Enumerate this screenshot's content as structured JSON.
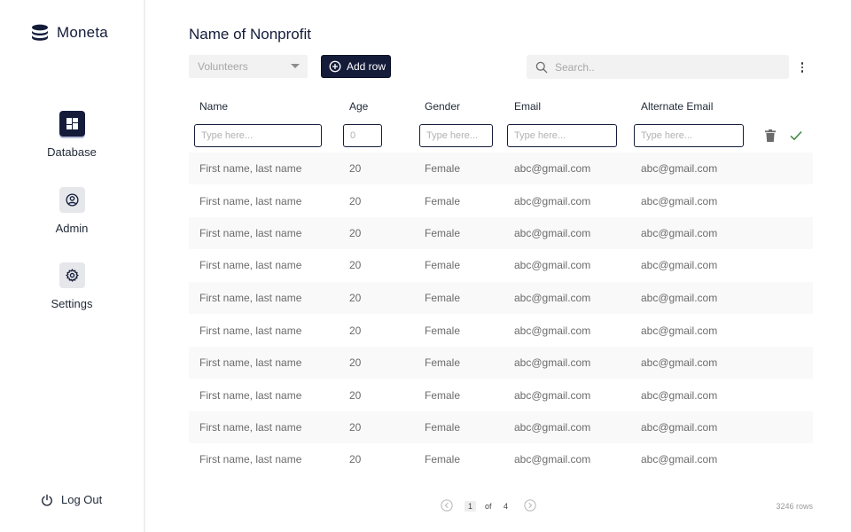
{
  "app": {
    "name": "Moneta"
  },
  "sidebar": {
    "items": [
      {
        "label": "Database",
        "icon": "grid-icon",
        "active": true
      },
      {
        "label": "Admin",
        "icon": "user-circle-icon",
        "active": false
      },
      {
        "label": "Settings",
        "icon": "gear-icon",
        "active": false
      }
    ],
    "logout_label": "Log Out"
  },
  "main": {
    "title": "Name of Nonprofit",
    "category_select": {
      "value": "Volunteers"
    },
    "add_row_label": "Add row",
    "search": {
      "placeholder": "Search.."
    }
  },
  "table": {
    "columns": [
      "Name",
      "Age",
      "Gender",
      "Email",
      "Alternate Email"
    ],
    "edit_row": {
      "name_placeholder": "Type here...",
      "age_placeholder": "0",
      "gender_placeholder": "Type here...",
      "email_placeholder": "Type here...",
      "alt_email_placeholder": "Type here..."
    },
    "rows": [
      [
        "First name, last name",
        "20",
        "Female",
        "abc@gmail.com",
        "abc@gmail.com"
      ],
      [
        "First name, last name",
        "20",
        "Female",
        "abc@gmail.com",
        "abc@gmail.com"
      ],
      [
        "First name, last name",
        "20",
        "Female",
        "abc@gmail.com",
        "abc@gmail.com"
      ],
      [
        "First name, last name",
        "20",
        "Female",
        "abc@gmail.com",
        "abc@gmail.com"
      ],
      [
        "First name, last name",
        "20",
        "Female",
        "abc@gmail.com",
        "abc@gmail.com"
      ],
      [
        "First name, last name",
        "20",
        "Female",
        "abc@gmail.com",
        "abc@gmail.com"
      ],
      [
        "First name, last name",
        "20",
        "Female",
        "abc@gmail.com",
        "abc@gmail.com"
      ],
      [
        "First name, last name",
        "20",
        "Female",
        "abc@gmail.com",
        "abc@gmail.com"
      ],
      [
        "First name, last name",
        "20",
        "Female",
        "abc@gmail.com",
        "abc@gmail.com"
      ],
      [
        "First name, last name",
        "20",
        "Female",
        "abc@gmail.com",
        "abc@gmail.com"
      ]
    ]
  },
  "pagination": {
    "current": "1",
    "of_label": "of",
    "total": "4",
    "row_count": "3246 rows"
  },
  "colors": {
    "brand_navy": "#141c3a",
    "row_shade": "#f9f9f9",
    "confirm_green": "#4c8a4c"
  }
}
